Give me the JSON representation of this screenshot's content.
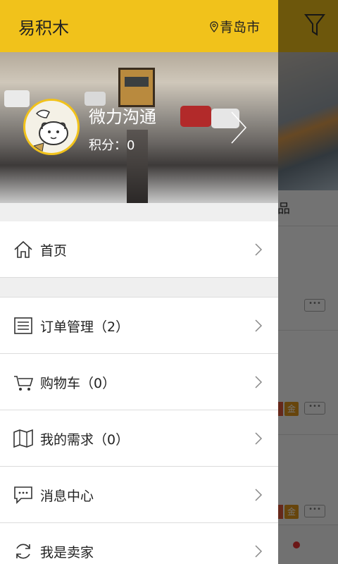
{
  "app": {
    "title": "易积木",
    "location": "青岛市"
  },
  "profile": {
    "username": "微力沟通",
    "points": "积分：0"
  },
  "menu": [
    {
      "label": "首页",
      "icon": "home-icon"
    },
    {
      "label": "订单管理（2）",
      "icon": "order-list-icon"
    },
    {
      "label": "购物车（0）",
      "icon": "cart-icon"
    },
    {
      "label": "我的需求（0）",
      "icon": "map-icon"
    },
    {
      "label": "消息中心",
      "icon": "message-icon"
    },
    {
      "label": "我是卖家",
      "icon": "refresh-icon"
    }
  ],
  "background": {
    "tab_fragment": "品",
    "badge": "金",
    "more": "•••"
  },
  "colors": {
    "accent": "#f1c21b",
    "badge": "#e59a1c",
    "text": "#222222"
  }
}
